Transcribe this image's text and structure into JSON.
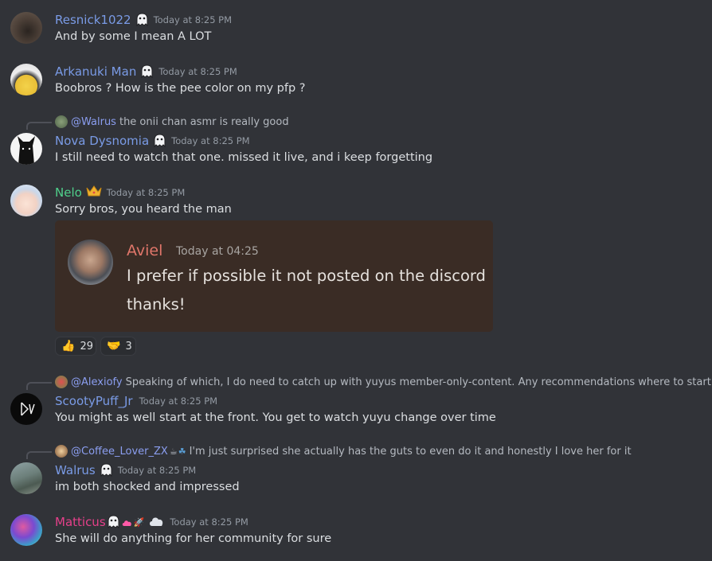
{
  "messages": [
    {
      "author": "Resnick1022",
      "author_color": "#7a9be6",
      "timestamp": "Today at 8:25 PM",
      "text": "And by some I mean A LOT"
    },
    {
      "author": "Arkanuki Man",
      "author_color": "#7a9be6",
      "timestamp": "Today at 8:25 PM",
      "text": "Boobros ? How is the pee color on my pfp ?"
    },
    {
      "author": "Nova Dysnomia",
      "author_color": "#7a9be6",
      "timestamp": "Today at 8:25 PM",
      "text": "I still need to watch that one. missed it live, and i keep forgetting",
      "reply": {
        "mention": "@Walrus",
        "text": "the onii chan asmr is really good"
      }
    },
    {
      "author": "Nelo",
      "author_color": "#4fd08b",
      "timestamp": "Today at 8:25 PM",
      "text": "Sorry bros, you heard the man",
      "embed": {
        "author": "Aviel",
        "timestamp": "Today at 04:25",
        "line1": "I prefer if possible it not posted on the discord",
        "line2": "thanks!"
      },
      "reactions": [
        {
          "emoji": "👍",
          "count": "29"
        },
        {
          "emoji": "🤝",
          "count": "3"
        }
      ]
    },
    {
      "author": "ScootyPuff_Jr",
      "author_color": "#7a9be6",
      "timestamp": "Today at 8:25 PM",
      "text": "You might as well start at the front. You get to watch yuyu change over time",
      "reply": {
        "mention": "@Alexiofy",
        "text": "Speaking of which, I do need to catch up with yuyus member-only-content. Any recommendations where to start"
      }
    },
    {
      "author": "Walrus",
      "author_color": "#7a9be6",
      "timestamp": "Today at 8:25 PM",
      "text": "im both shocked and impressed",
      "reply": {
        "mention": "@Coffee_Lover_ZX",
        "text": "I'm just surprised she actually has the guts to even do it and honestly I love her for it"
      }
    },
    {
      "author": "Matticus",
      "author_color": "#e5408a",
      "timestamp": "Today at 8:25 PM",
      "text": "She will do anything for her community for sure"
    }
  ],
  "icons": {
    "ghost": "ghost-badge-icon",
    "crown": "crown-badge-icon",
    "coffee": "☕",
    "clover": "☘",
    "cloud": "☁",
    "rocket": "🚀"
  }
}
